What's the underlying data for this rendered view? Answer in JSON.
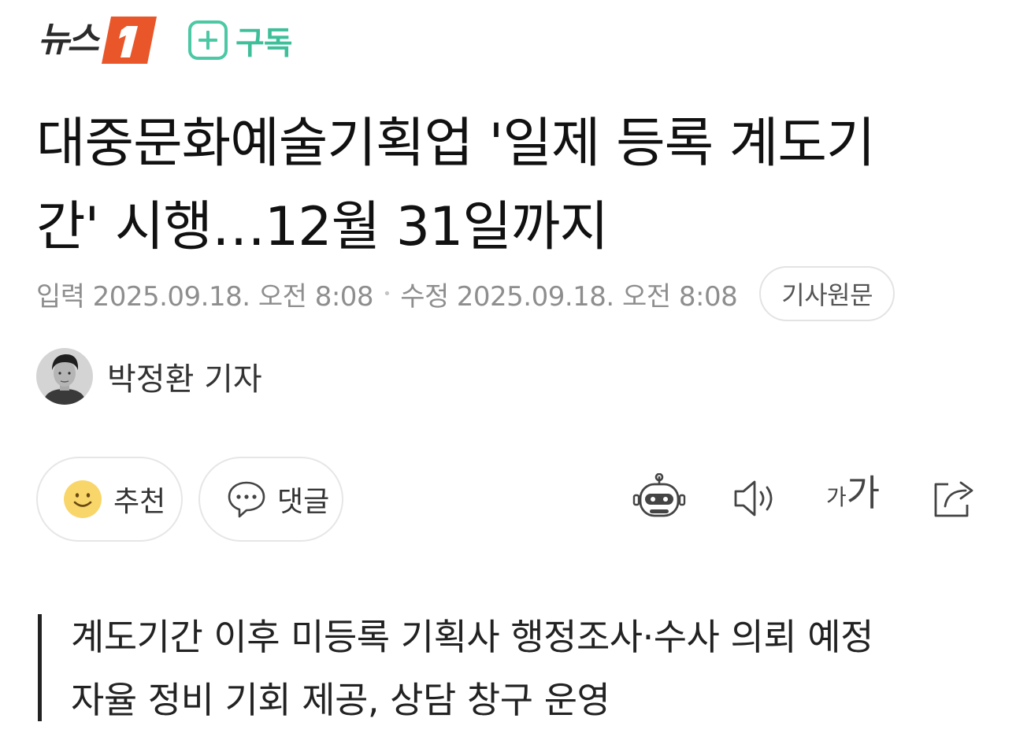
{
  "header": {
    "logo_text": "뉴스1",
    "logo_brand_color": "#e8562a",
    "subscribe_label": "구독",
    "subscribe_icon": "plus-icon",
    "accent_color": "#3fbf99"
  },
  "article": {
    "title_line1": "대중문화예술기획업 '일제 등록 계도기",
    "title_line2": "간' 시행…12월 31일까지",
    "input_label": "입력",
    "input_datetime": "2025.09.18. 오전 8:08",
    "modified_label": "수정",
    "modified_datetime": "2025.09.18. 오전 8:08",
    "source_button_label": "기사원문",
    "reporter_name": "박정환 기자"
  },
  "actions": {
    "like_label": "추천",
    "like_icon": "smiley-icon",
    "comment_label": "댓글",
    "comment_icon": "speech-bubble-icon",
    "tools": [
      {
        "name": "ai-summary-bot-icon"
      },
      {
        "name": "speaker-icon"
      },
      {
        "name": "font-size-icon",
        "small": "가",
        "big": "가"
      },
      {
        "name": "share-icon"
      }
    ]
  },
  "summary": {
    "lines": [
      "계도기간 이후 미등록 기획사 행정조사·수사 의뢰 예정",
      "자율 정비 기회 제공, 상담 창구 운영"
    ]
  }
}
